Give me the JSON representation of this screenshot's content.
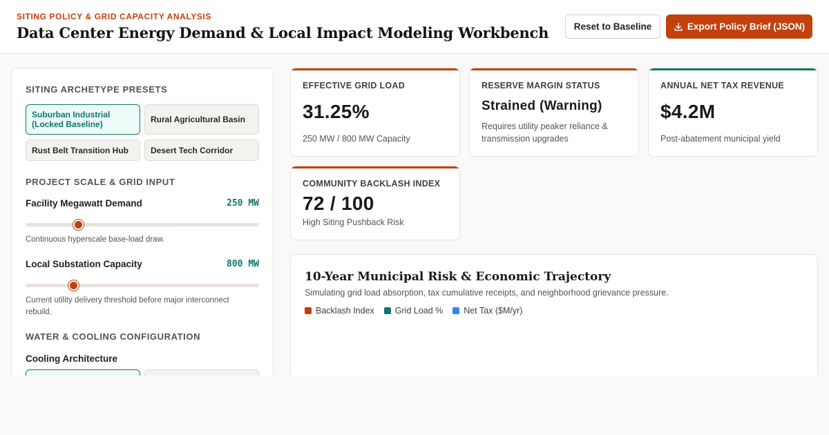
{
  "header": {
    "kicker": "SITING POLICY & GRID CAPACITY ANALYSIS",
    "title": "Data Center Energy Demand & Local Impact Modeling Workbench",
    "reset_label": "Reset to Baseline",
    "export_label": "Export Policy Brief (JSON)"
  },
  "sidebar": {
    "presets_title": "SITING ARCHETYPE PRESETS",
    "presets": [
      {
        "label": "Suburban Industrial (Locked Baseline)",
        "active": true
      },
      {
        "label": "Rural Agricultural Basin",
        "active": false
      },
      {
        "label": "Rust Belt Transition Hub",
        "active": false
      },
      {
        "label": "Desert Tech Corridor",
        "active": false
      }
    ],
    "scale_title": "PROJECT SCALE & GRID INPUT",
    "megawatt": {
      "label": "Facility Megawatt Demand",
      "value": "250 MW",
      "fraction": 0.225,
      "help": "Continuous hyperscale base-load draw."
    },
    "substation": {
      "label": "Local Substation Capacity",
      "value": "800 MW",
      "fraction": 0.205,
      "help": "Current utility delivery threshold before major interconnect rebuild."
    },
    "water_title": "WATER & COOLING CONFIGURATION",
    "cooling_label": "Cooling Architecture"
  },
  "cards": {
    "grid_load": {
      "label": "EFFECTIVE GRID LOAD",
      "value": "31.25%",
      "sub": "250 MW / 800 MW Capacity",
      "accent": "#c2410c"
    },
    "reserve": {
      "label": "RESERVE MARGIN STATUS",
      "value": "Strained (Warning)",
      "sub": "Requires utility peaker reliance & transmission upgrades",
      "accent": "#c2410c"
    },
    "tax": {
      "label": "ANNUAL NET TAX REVENUE",
      "value": "$4.2M",
      "sub": "Post-abatement municipal yield",
      "accent": "#0f766e"
    },
    "backlash": {
      "label": "COMMUNITY BACKLASH INDEX",
      "value": "72 / 100",
      "sub": "High Siting Pushback Risk",
      "accent": "#c2410c"
    }
  },
  "chart": {
    "title": "10-Year Municipal Risk & Economic Trajectory",
    "subtitle": "Simulating grid load absorption, tax cumulative receipts, and neighborhood grievance pressure.",
    "legend": [
      {
        "name": "Backlash Index",
        "color": "#c2410c"
      },
      {
        "name": "Grid Load %",
        "color": "#0f766e"
      },
      {
        "name": "Net Tax ($M/yr)",
        "color": "#3b82f6"
      }
    ]
  },
  "colors": {
    "accent": "#c2410c",
    "teal": "#0f766e",
    "blue": "#3b82f6"
  },
  "icons": {
    "export": "download-icon"
  }
}
